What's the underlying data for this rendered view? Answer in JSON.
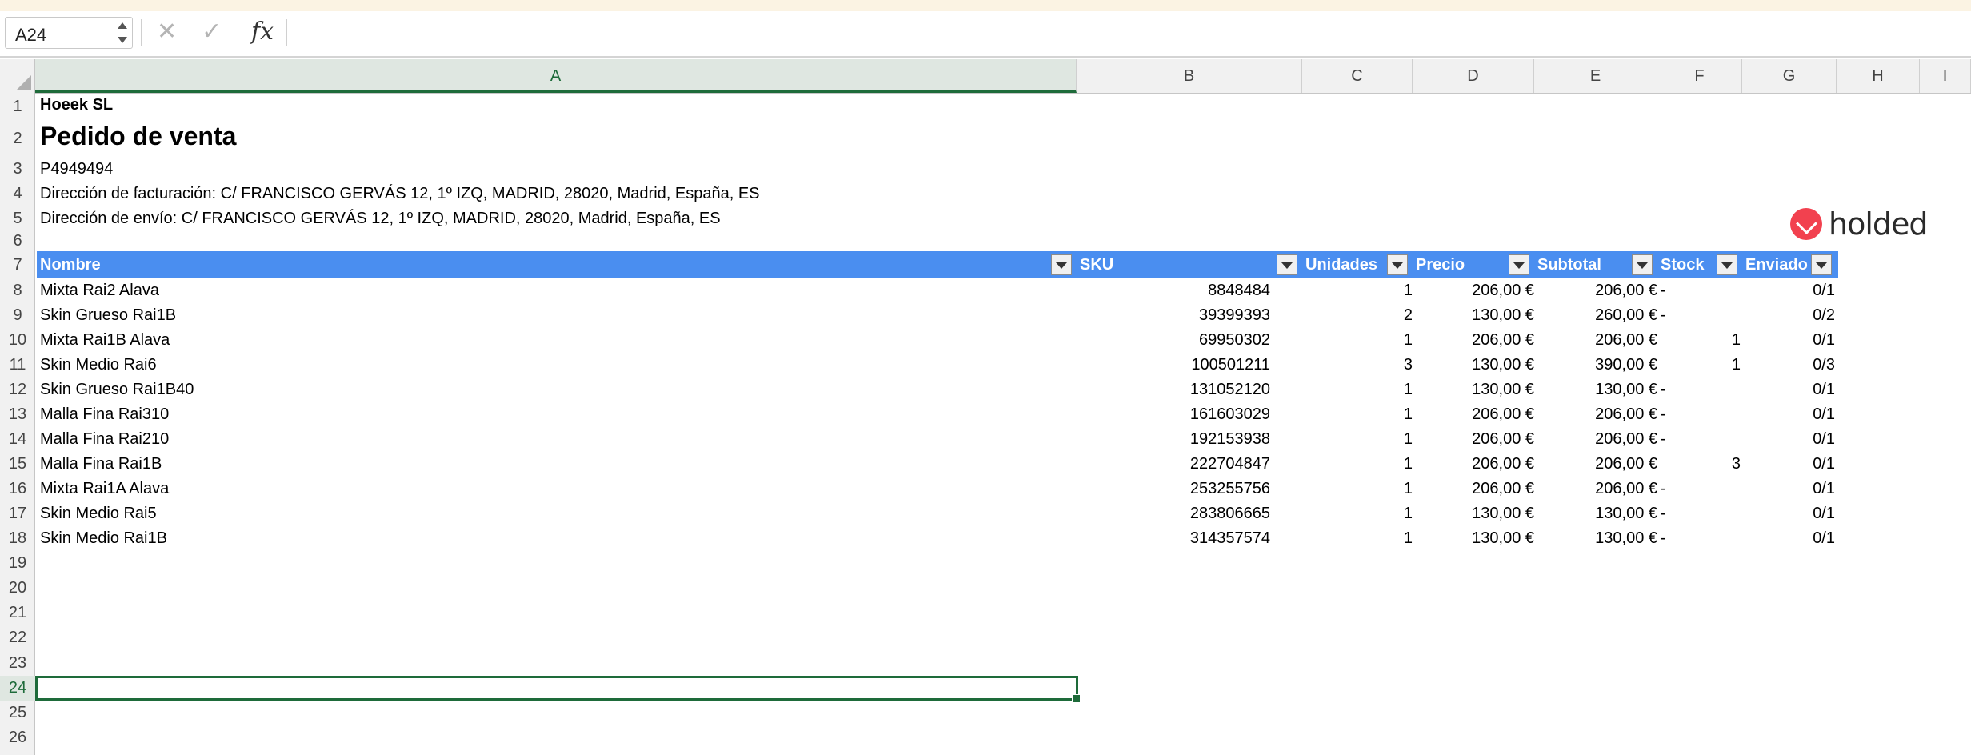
{
  "formula_bar": {
    "name_box": "A24",
    "fx_label": "fx",
    "formula": "",
    "cancel_icon": "x-icon",
    "enter_icon": "check-icon"
  },
  "columns": [
    "A",
    "B",
    "C",
    "D",
    "E",
    "F",
    "G",
    "H",
    "I"
  ],
  "rows": [
    "1",
    "2",
    "3",
    "4",
    "5",
    "6",
    "7",
    "8",
    "9",
    "10",
    "11",
    "12",
    "13",
    "14",
    "15",
    "16",
    "17",
    "18",
    "19",
    "20",
    "21",
    "22",
    "23",
    "24",
    "25",
    "26"
  ],
  "selected_cell": "A24",
  "sheet": {
    "company": "Hoeek SL",
    "doc_title": "Pedido de venta",
    "doc_number": "P4949494",
    "billing_address": "Dirección de facturación: C/ FRANCISCO GERVÁS 12, 1º IZQ, MADRID, 28020, Madrid, España, ES",
    "shipping_address": "Dirección de envío: C/ FRANCISCO GERVÁS 12, 1º IZQ, MADRID, 28020, Madrid, España, ES",
    "logo_text": "holded"
  },
  "table": {
    "headers": [
      "Nombre",
      "SKU",
      "Unidades",
      "Precio",
      "Subtotal",
      "Stock",
      "Enviado"
    ],
    "rows": [
      {
        "nombre": "Mixta Rai2 Alava",
        "sku": "8848484",
        "unidades": "1",
        "precio": "206,00 €",
        "subtotal": "206,00 €",
        "stock": "-",
        "enviado": "0/1"
      },
      {
        "nombre": "Skin Grueso Rai1B",
        "sku": "39399393",
        "unidades": "2",
        "precio": "130,00 €",
        "subtotal": "260,00 €",
        "stock": "-",
        "enviado": "0/2"
      },
      {
        "nombre": "Mixta Rai1B Alava",
        "sku": "69950302",
        "unidades": "1",
        "precio": "206,00 €",
        "subtotal": "206,00 €",
        "stock": "1",
        "enviado": "0/1"
      },
      {
        "nombre": "Skin Medio Rai6",
        "sku": "100501211",
        "unidades": "3",
        "precio": "130,00 €",
        "subtotal": "390,00 €",
        "stock": "1",
        "enviado": "0/3"
      },
      {
        "nombre": "Skin Grueso Rai1B40",
        "sku": "131052120",
        "unidades": "1",
        "precio": "130,00 €",
        "subtotal": "130,00 €",
        "stock": "-",
        "enviado": "0/1"
      },
      {
        "nombre": "Malla Fina Rai310",
        "sku": "161603029",
        "unidades": "1",
        "precio": "206,00 €",
        "subtotal": "206,00 €",
        "stock": "-",
        "enviado": "0/1"
      },
      {
        "nombre": "Malla Fina Rai210",
        "sku": "192153938",
        "unidades": "1",
        "precio": "206,00 €",
        "subtotal": "206,00 €",
        "stock": "-",
        "enviado": "0/1"
      },
      {
        "nombre": "Malla Fina Rai1B",
        "sku": "222704847",
        "unidades": "1",
        "precio": "206,00 €",
        "subtotal": "206,00 €",
        "stock": "3",
        "enviado": "0/1"
      },
      {
        "nombre": "Mixta Rai1A Alava",
        "sku": "253255756",
        "unidades": "1",
        "precio": "206,00 €",
        "subtotal": "206,00 €",
        "stock": "-",
        "enviado": "0/1"
      },
      {
        "nombre": "Skin Medio Rai5",
        "sku": "283806665",
        "unidades": "1",
        "precio": "130,00 €",
        "subtotal": "130,00 €",
        "stock": "-",
        "enviado": "0/1"
      },
      {
        "nombre": "Skin Medio Rai1B",
        "sku": "314357574",
        "unidades": "1",
        "precio": "130,00 €",
        "subtotal": "130,00 €",
        "stock": "-",
        "enviado": "0/1"
      }
    ]
  },
  "colors": {
    "table_header": "#4a8ef0",
    "selection": "#1e6b3a",
    "logo": "#f2414f"
  }
}
